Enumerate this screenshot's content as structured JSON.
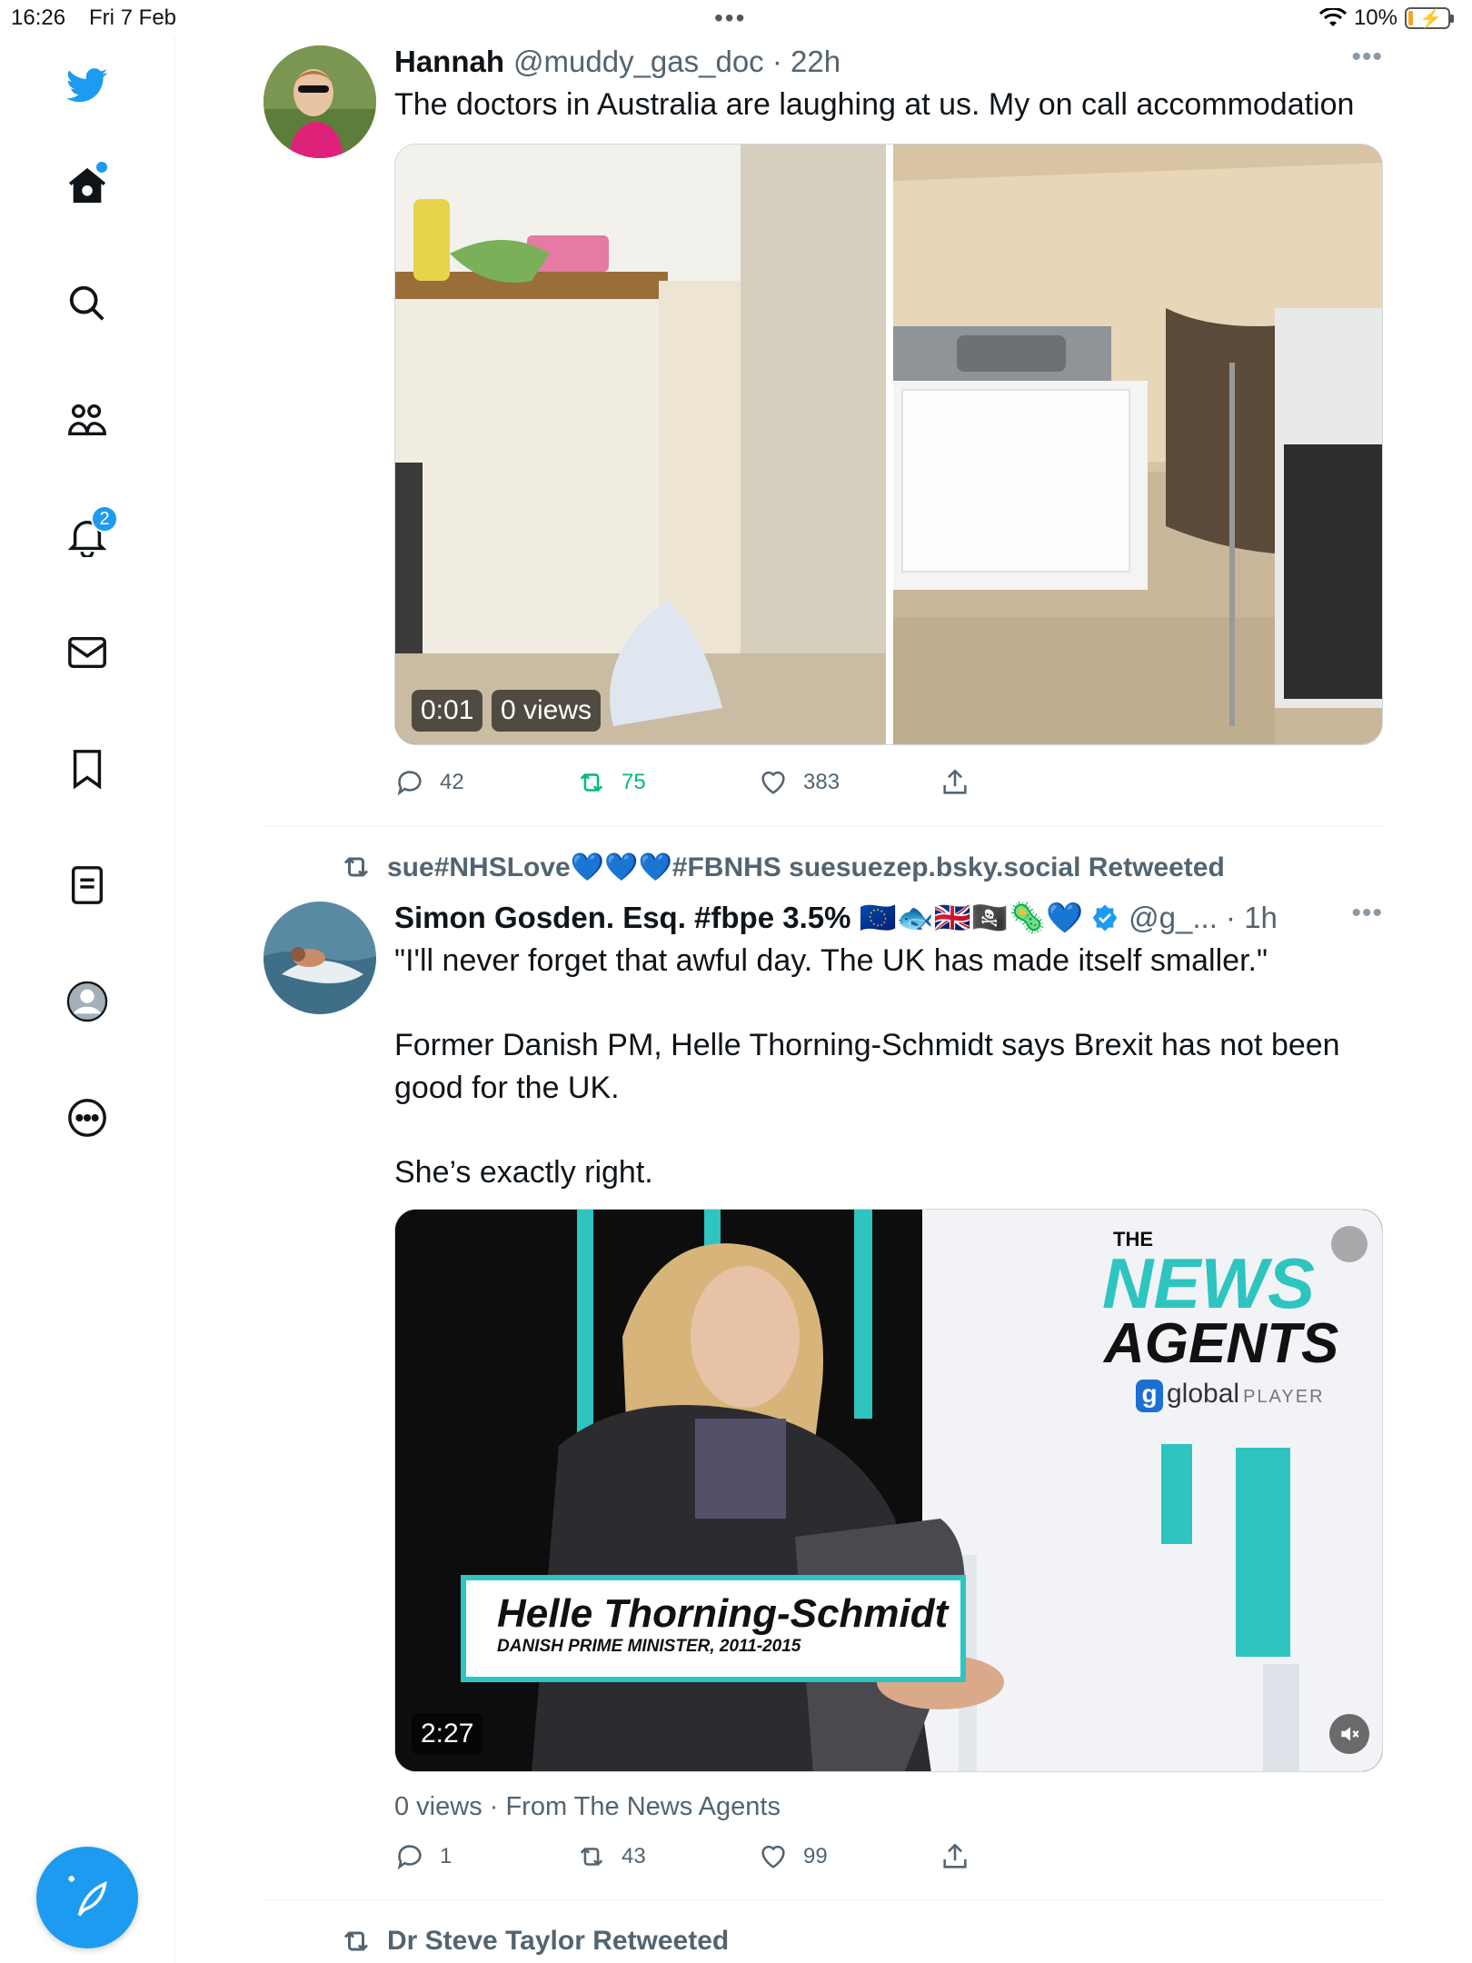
{
  "status": {
    "time": "16:26",
    "date": "Fri 7 Feb",
    "battery": "10%"
  },
  "sidebar": {
    "notifications_badge": "2",
    "items": [
      "twitter-logo",
      "home",
      "explore",
      "communities",
      "notifications",
      "messages",
      "bookmarks",
      "lists",
      "profile",
      "more"
    ]
  },
  "tweets": [
    {
      "name": "Hannah",
      "handle": "@muddy_gas_doc · 22h",
      "text": "The doctors in Australia are laughing at us. My on call accommodation",
      "video_time": "0:01",
      "video_views": "0 views",
      "replies": "42",
      "retweets": "75",
      "likes": "383"
    },
    {
      "retweeted_by": "sue#NHSLove💙💙💙#FBNHS suesuezep.bsky.social Retweeted",
      "name": "Simon Gosden. Esq. #fbpe 3.5% 🇪🇺🐟🇬🇧🏴‍☠️🦠💙",
      "handle": "@g_... · 1h",
      "text_lines": [
        "\"I'll never forget that awful day. The UK has made itself smaller.\"",
        "Former Danish PM, Helle Thorning-Schmidt says Brexit has not been good for the UK.",
        "She’s exactly right."
      ],
      "video": {
        "brand_top": "THE",
        "brand_news": "NEWS",
        "brand_agents": "AGENTS",
        "brand_global": "global",
        "brand_player": "PLAYER",
        "caption_name": "Helle Thorning-Schmidt",
        "caption_title": "DANISH PRIME MINISTER, 2011-2015",
        "duration": "2:27"
      },
      "meta": "0 views · From The News Agents",
      "replies": "1",
      "retweets": "43",
      "likes": "99"
    }
  ],
  "next_retweet_line": "Dr Steve Taylor Retweeted",
  "colors": {
    "accent": "#1d9bf0",
    "retweet": "#00ba7c",
    "teal": "#2ec4c0"
  }
}
